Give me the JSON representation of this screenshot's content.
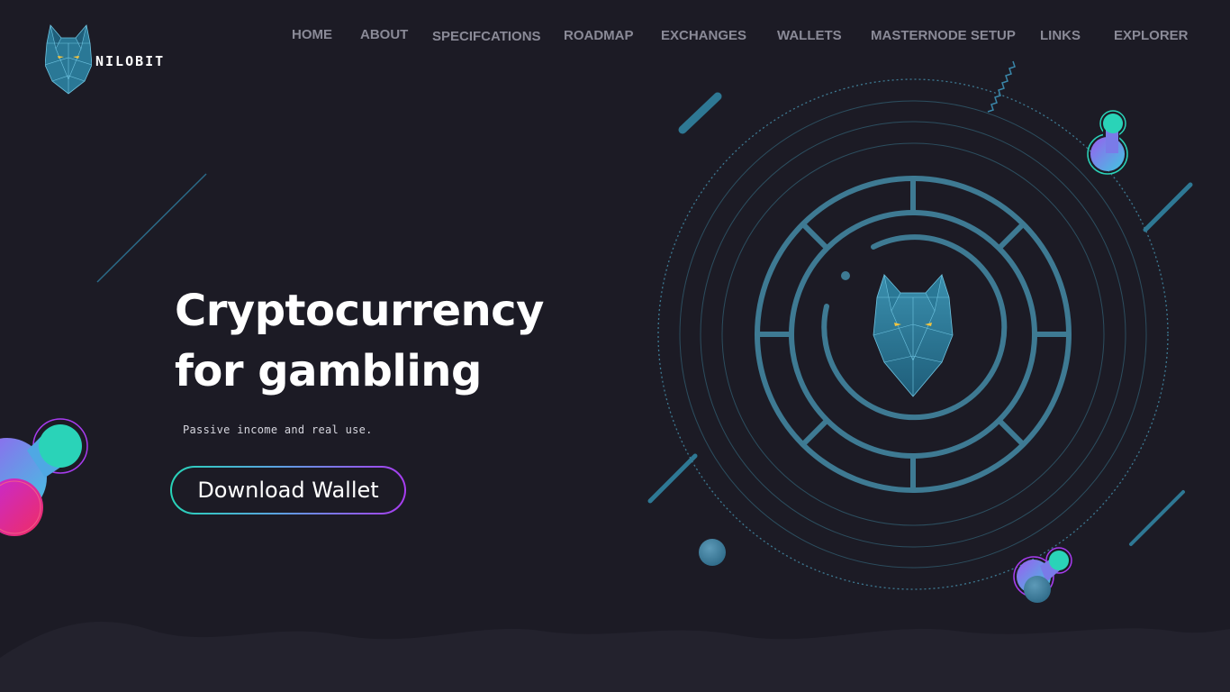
{
  "brand": {
    "name": "NILOBIT",
    "logo_icon": "wolf-head-icon"
  },
  "nav": {
    "items": [
      {
        "label": "HOME"
      },
      {
        "label": "ABOUT"
      },
      {
        "label": "SPECIFCATIONS"
      },
      {
        "label": "ROADMAP"
      },
      {
        "label": "EXCHANGES"
      },
      {
        "label": "WALLETS"
      },
      {
        "label": "MASTERNODE SETUP"
      },
      {
        "label": "LINKS"
      },
      {
        "label": "EXPLORER"
      }
    ]
  },
  "hero": {
    "title_line1": "Cryptocurrency",
    "title_line2": "for gambling",
    "subtitle": "Passive income and real use.",
    "cta_label": "Download Wallet"
  },
  "colors": {
    "background": "#1c1b25",
    "accent_teal": "#2ad3b8",
    "accent_purple": "#a83cf0",
    "accent_pink": "#e0287a",
    "ring_blue": "#3e7a93",
    "nav_text": "#8a8a97"
  }
}
